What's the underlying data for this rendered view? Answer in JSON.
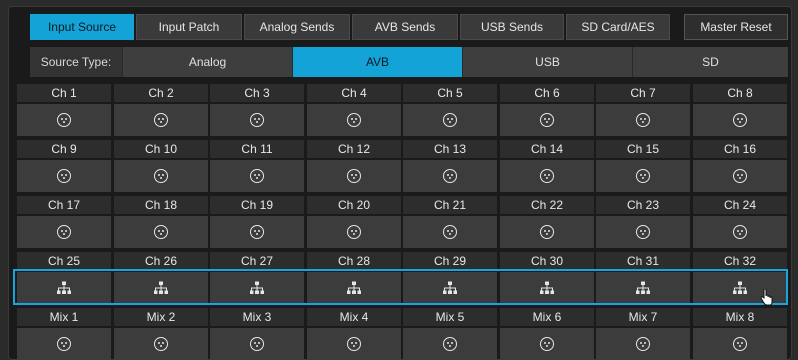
{
  "tabs": [
    {
      "label": "Input Source",
      "active": true
    },
    {
      "label": "Input Patch",
      "active": false
    },
    {
      "label": "Analog Sends",
      "active": false
    },
    {
      "label": "AVB Sends",
      "active": false
    },
    {
      "label": "USB Sends",
      "active": false
    },
    {
      "label": "SD Card/AES",
      "active": false
    },
    {
      "label": "Master Reset",
      "active": false
    }
  ],
  "source_type": {
    "label": "Source Type:",
    "options": [
      "Analog",
      "AVB",
      "USB",
      "SD"
    ],
    "selected": "AVB"
  },
  "rows": [
    {
      "channels": [
        "Ch 1",
        "Ch 2",
        "Ch 3",
        "Ch 4",
        "Ch 5",
        "Ch 6",
        "Ch 7",
        "Ch 8"
      ],
      "icon": "xlr-input-icon"
    },
    {
      "channels": [
        "Ch 9",
        "Ch 10",
        "Ch 11",
        "Ch 12",
        "Ch 13",
        "Ch 14",
        "Ch 15",
        "Ch 16"
      ],
      "icon": "xlr-input-icon"
    },
    {
      "channels": [
        "Ch 17",
        "Ch 18",
        "Ch 19",
        "Ch 20",
        "Ch 21",
        "Ch 22",
        "Ch 23",
        "Ch 24"
      ],
      "icon": "xlr-input-icon"
    },
    {
      "channels": [
        "Ch 25",
        "Ch 26",
        "Ch 27",
        "Ch 28",
        "Ch 29",
        "Ch 30",
        "Ch 31",
        "Ch 32"
      ],
      "icon": "network-avb-icon"
    },
    {
      "channels": [
        "Mix 1",
        "Mix 2",
        "Mix 3",
        "Mix 4",
        "Mix 5",
        "Mix 6",
        "Mix 7",
        "Mix 8"
      ],
      "icon": "xlr-input-icon"
    }
  ],
  "colors": {
    "accent": "#14a3d6",
    "background": "#1a1a1a",
    "cell": "#3c3c3c"
  }
}
